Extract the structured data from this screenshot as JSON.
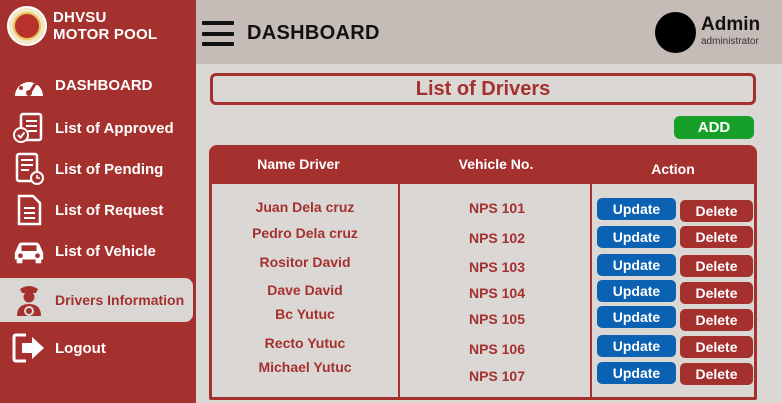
{
  "brand": {
    "line1": "DHVSU",
    "line2": "MOTOR POOL"
  },
  "sidebar": {
    "items": [
      {
        "label": "DASHBOARD",
        "icon": "dashboard-gauge-icon"
      },
      {
        "label": "List of Approved",
        "icon": "approved-document-icon"
      },
      {
        "label": "List of Pending",
        "icon": "pending-document-icon"
      },
      {
        "label": "List of Request",
        "icon": "request-document-icon"
      },
      {
        "label": "List of Vehicle",
        "icon": "car-icon"
      },
      {
        "label": "Drivers Information",
        "icon": "driver-icon",
        "active": true
      },
      {
        "label": "Logout",
        "icon": "logout-icon"
      }
    ]
  },
  "header": {
    "title": "DASHBOARD",
    "user_name": "Admin",
    "user_role": "administrator"
  },
  "main": {
    "list_title": "List of Drivers",
    "add_label": "ADD",
    "columns": [
      "Name Driver",
      "Vehicle No.",
      "Action"
    ],
    "rows": [
      {
        "name": "Juan Dela cruz",
        "vehicle": "NPS 101"
      },
      {
        "name": "Pedro Dela cruz",
        "vehicle": "NPS 102"
      },
      {
        "name": "Rositor David",
        "vehicle": "NPS 103"
      },
      {
        "name": "Dave David",
        "vehicle": "NPS 104"
      },
      {
        "name": "Bc Yutuc",
        "vehicle": "NPS 105"
      },
      {
        "name": "Recto Yutuc",
        "vehicle": "NPS 106"
      },
      {
        "name": "Michael Yutuc",
        "vehicle": "NPS 107"
      }
    ],
    "update_label": "Update",
    "delete_label": "Delete"
  },
  "colors": {
    "sidebar": "#a5312f",
    "header": "#c5bcb8",
    "content": "#dad7d5",
    "update": "#0b62b3",
    "delete": "#a5312f",
    "add": "#16a02a"
  }
}
